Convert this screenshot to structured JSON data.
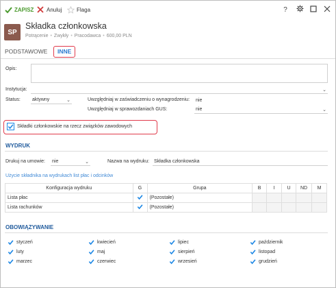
{
  "toolbar": {
    "save_label": "ZAPISZ",
    "cancel_label": "Anuluj",
    "flag_label": "Flaga",
    "help_glyph": "?"
  },
  "header": {
    "avatar": "SP",
    "title": "Składka członkowska",
    "subtitle": [
      "Potrącenie",
      "Zwykły",
      "Pracodawca",
      "600,00 PLN"
    ]
  },
  "tabs": [
    "PODSTAWOWE",
    "INNE"
  ],
  "active_tab": "INNE",
  "form": {
    "opis_label": "Opis:",
    "opis_value": "",
    "instytucja_label": "Instytucja:",
    "instytucja_value": "",
    "status_label": "Status:",
    "status_value": "aktywny",
    "uwzgl_zasw_label": "Uwzględniaj w zaświadczeniu o wynagrodzeniu:",
    "uwzgl_zasw_value": "nie",
    "uwzgl_gus_label": "Uwzględniaj w sprawozdaniach GUS:",
    "uwzgl_gus_value": "nie",
    "zwiazki_label": "Składki członkowskie na rzecz związków zawodowych",
    "zwiazki_checked": true
  },
  "wydruk": {
    "section": "WYDRUK",
    "drukuj_label": "Drukuj na umowie:",
    "drukuj_value": "nie",
    "nazwa_label": "Nazwa na wydruku:",
    "nazwa_value": "Składka członkowska",
    "hint": "Użycie składnika na wydrukach list płac i odcinków",
    "table": {
      "headers": [
        "Konfiguracja wydruku",
        "G",
        "Grupa",
        "B",
        "I",
        "U",
        "ND",
        "M"
      ],
      "rows": [
        {
          "name": "Lista płac",
          "g": true,
          "grupa": "(Pozostałe)"
        },
        {
          "name": "Lista rachunków",
          "g": true,
          "grupa": "(Pozostałe)"
        }
      ]
    }
  },
  "obowiazywanie": {
    "section": "OBOWIĄZYWANIE",
    "months": [
      "styczeń",
      "kwiecień",
      "lipiec",
      "październik",
      "luty",
      "maj",
      "sierpień",
      "listopad",
      "marzec",
      "czerwiec",
      "wrzesień",
      "grudzień"
    ]
  },
  "colors": {
    "accent": "#2b7bd0",
    "save_green": "#4b9a2e",
    "highlight_red": "#e0394a",
    "avatar_bg": "#8b5a4e",
    "check_blue": "#1e88e5"
  }
}
